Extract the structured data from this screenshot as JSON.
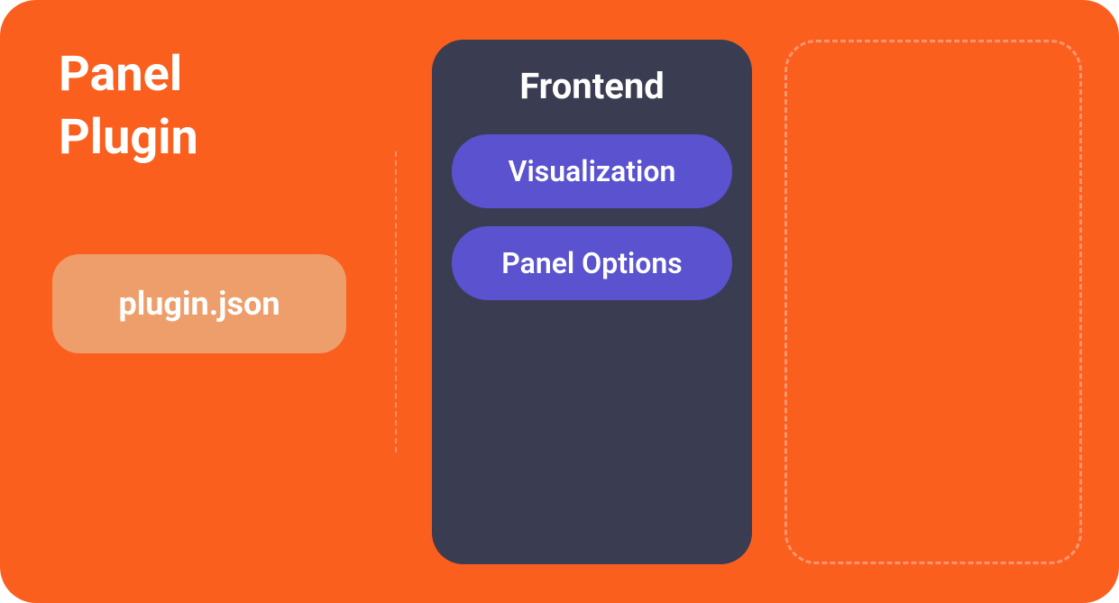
{
  "title": {
    "line1": "Panel",
    "line2": "Plugin"
  },
  "plugin_badge": "plugin.json",
  "frontend": {
    "title": "Frontend",
    "items": [
      "Visualization",
      "Panel Options"
    ]
  },
  "colors": {
    "background": "#fa5f1e",
    "badge": "#ee9e6a",
    "panel_dark": "#3a3c51",
    "pill": "#5a52cf",
    "text": "#ffffff"
  }
}
